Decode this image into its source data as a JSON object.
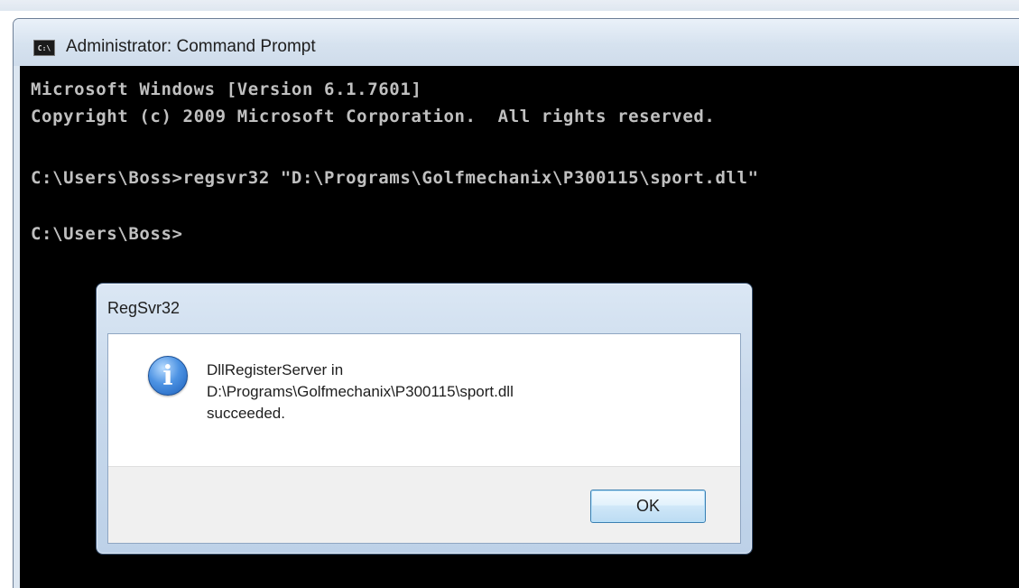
{
  "window": {
    "title": "Administrator: Command Prompt",
    "icon": "command-prompt-icon",
    "icon_text": "C:\\"
  },
  "console": {
    "lines": [
      "Microsoft Windows [Version 6.1.7601]",
      "Copyright (c) 2009 Microsoft Corporation.  All rights reserved.",
      "",
      "C:\\Users\\Boss>regsvr32 \"D:\\Programs\\Golfmechanix\\P300115\\sport.dll\"",
      "",
      "C:\\Users\\Boss>"
    ],
    "text_color": "#c0c0c0",
    "background": "#000000"
  },
  "dialog": {
    "title": "RegSvr32",
    "icon": "information-icon",
    "icon_glyph": "i",
    "message_lines": [
      "DllRegisterServer in",
      "D:\\Programs\\Golfmechanix\\P300115\\sport.dll",
      "succeeded."
    ],
    "ok_label": "OK"
  }
}
